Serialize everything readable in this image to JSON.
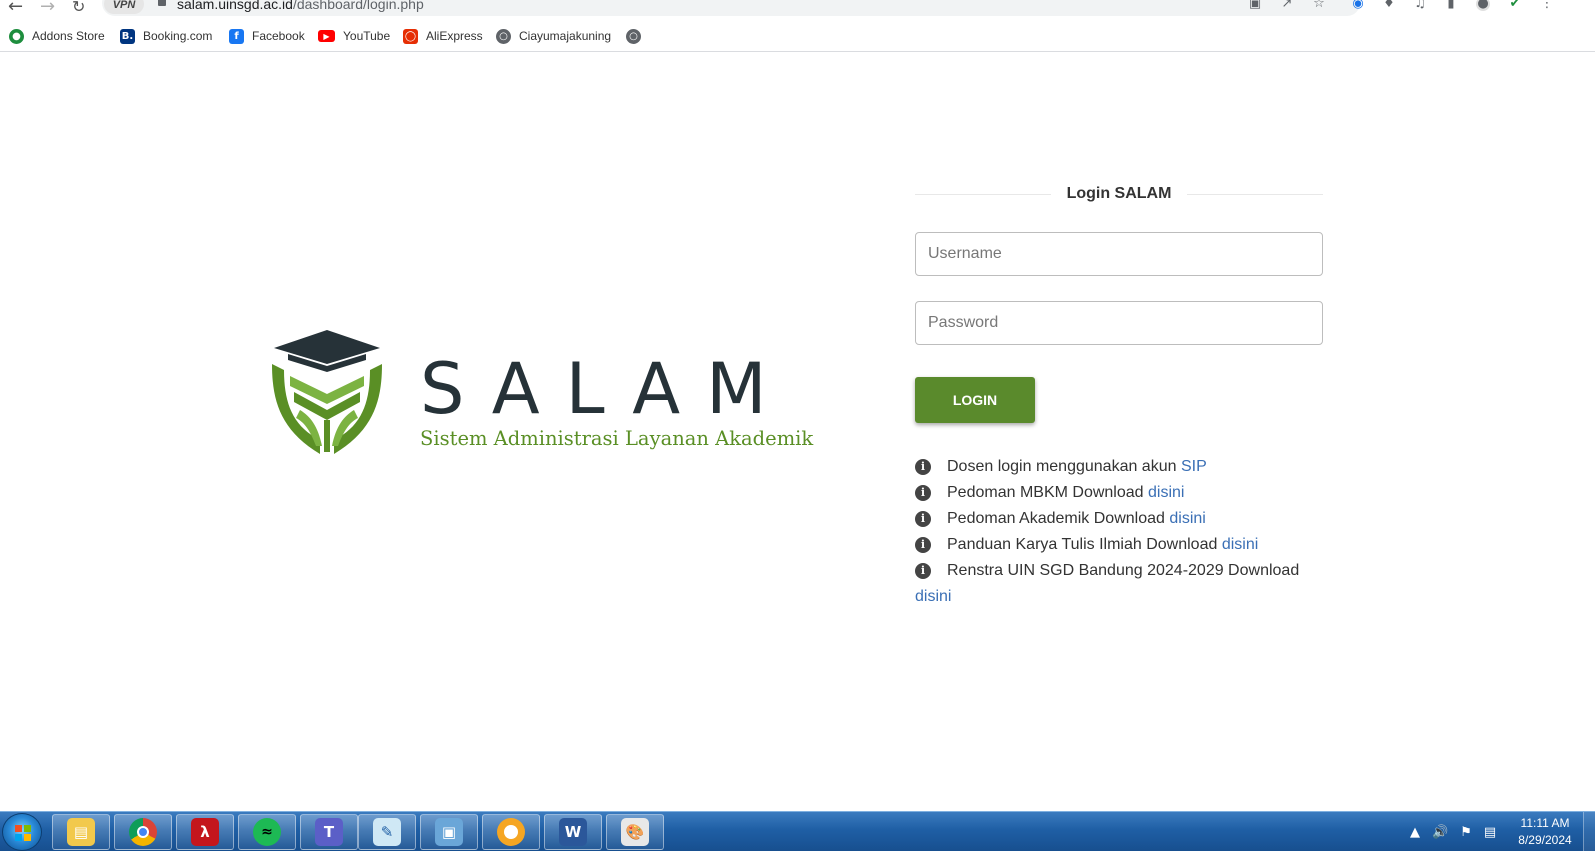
{
  "browser": {
    "vpn_label": "VPN",
    "url_host": "salam.uinsgd.ac.id",
    "url_path": "/dashboard/login.php"
  },
  "bookmarks": [
    {
      "label": "Addons Store",
      "icon": "addons-store-icon",
      "color": "#1e8e3e"
    },
    {
      "label": "Booking.com",
      "icon": "booking-icon",
      "color": "#003580"
    },
    {
      "label": "Facebook",
      "icon": "facebook-icon",
      "color": "#1877f2"
    },
    {
      "label": "YouTube",
      "icon": "youtube-icon",
      "color": "#ff0000"
    },
    {
      "label": "AliExpress",
      "icon": "aliexpress-icon",
      "color": "#e62e04"
    },
    {
      "label": "Ciayumajakuning",
      "icon": "globe-icon",
      "color": "#5f6368"
    }
  ],
  "logo": {
    "word": "SALAM",
    "subtitle": "Sistem Administrasi Layanan Akademik",
    "dark_color": "#263238",
    "green_color": "#5a8f25"
  },
  "login": {
    "heading": "Login SALAM",
    "username_placeholder": "Username",
    "password_placeholder": "Password",
    "button_label": "LOGIN",
    "button_color": "#5a8a2c"
  },
  "info": [
    {
      "text": "Dosen login menggunakan akun ",
      "link": "SIP"
    },
    {
      "text": "Pedoman MBKM Download ",
      "link": "disini"
    },
    {
      "text": "Pedoman Akademik Download ",
      "link": "disini"
    },
    {
      "text": "Panduan Karya Tulis Ilmiah Download ",
      "link": "disini"
    },
    {
      "text": "Renstra UIN SGD Bandung 2024-2029 Download ",
      "link": "disini"
    }
  ],
  "taskbar": {
    "apps": [
      {
        "name": "file-explorer-icon"
      },
      {
        "name": "chrome-icon"
      },
      {
        "name": "acrobat-icon"
      },
      {
        "name": "spotify-icon"
      },
      {
        "name": "teams-icon"
      },
      {
        "name": "notepad-icon"
      },
      {
        "name": "photo-viewer-icon"
      },
      {
        "name": "vpn-app-icon"
      },
      {
        "name": "word-icon",
        "letter": "W"
      },
      {
        "name": "paint-icon"
      }
    ],
    "clock_time": "11:11 AM",
    "clock_date": "8/29/2024"
  }
}
